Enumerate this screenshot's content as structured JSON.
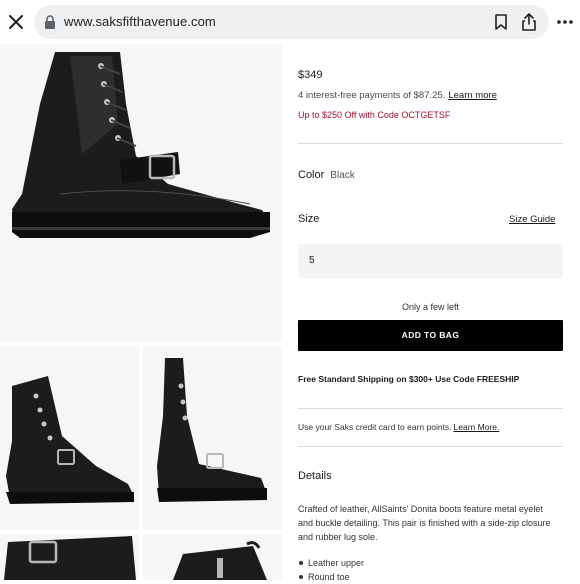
{
  "browser": {
    "url": "www.saksfifthavenue.com"
  },
  "product": {
    "price": "$349",
    "installment_text": "4 interest-free payments of $87.25.",
    "installment_link": "Learn more",
    "promo": "Up to $250 Off with Code OCTGETSF",
    "color_label": "Color",
    "color_value": "Black",
    "size_label": "Size",
    "size_guide": "Size Guide",
    "size_selected": "5",
    "stock_note": "Only a few left",
    "add_to_bag": "ADD TO BAG",
    "shipping_note": "Free Standard Shipping on $300+ Use Code FREESHIP",
    "credit_text": "Use your Saks credit card to earn points.",
    "credit_link": "Learn More.",
    "details_heading": "Details",
    "details_body": "Crafted of leather, AllSaints' Donita boots feature metal eyelet and buckle detailing. This pair is finished with a side-zip closure and rubber lug sole.",
    "details_bullets": [
      "Leather upper",
      "Round toe"
    ]
  },
  "colors": {
    "promo": "#a4122a",
    "button_bg": "#000000",
    "tile_bg": "#f6f6f6"
  },
  "icons": [
    "close-icon",
    "lock-icon",
    "bookmark-icon",
    "share-icon",
    "more-icon"
  ]
}
